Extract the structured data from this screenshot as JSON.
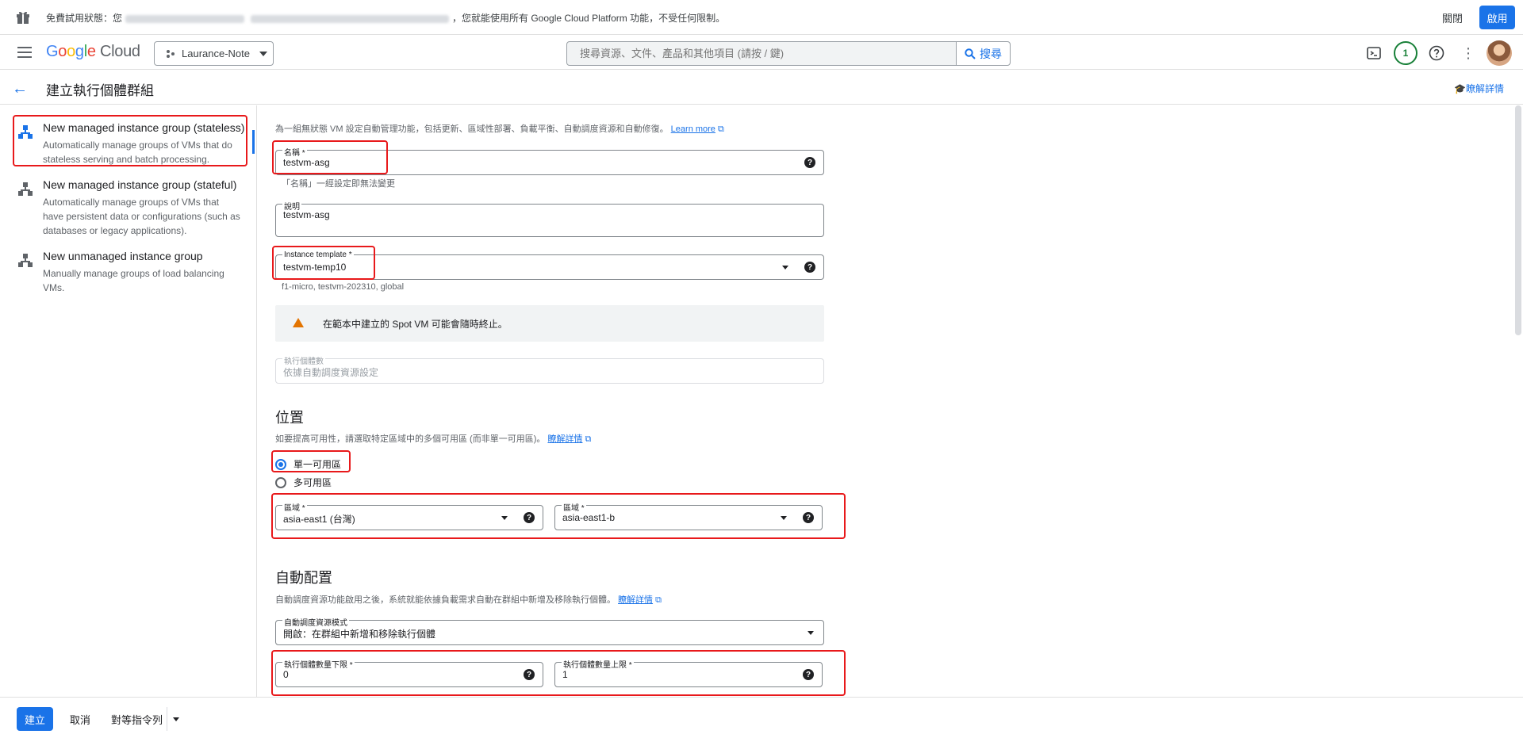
{
  "trial_banner": {
    "text_prefix": "免費試用狀態：您",
    "text_suffix": "，您就能使用所有 Google Cloud Platform 功能，不受任何限制。",
    "close_label": "關閉",
    "activate_label": "啟用"
  },
  "header": {
    "logo_parts": [
      "G",
      "o",
      "o",
      "g",
      "l",
      "e"
    ],
    "logo_product": "Cloud",
    "project_name": "Laurance-Note",
    "search_placeholder": "搜尋資源、文件、產品和其他項目 (請按 / 鍵)",
    "search_button": "搜尋",
    "notification_count": "1"
  },
  "titlebar": {
    "title": "建立執行個體群組",
    "learn_label": "瞭解詳情"
  },
  "sidebar": {
    "items": [
      {
        "title": "New managed instance group (stateless)",
        "desc": "Automatically manage groups of VMs that do stateless serving and batch processing."
      },
      {
        "title": "New managed instance group (stateful)",
        "desc": "Automatically manage groups of VMs that have persistent data or configurations (such as databases or legacy applications)."
      },
      {
        "title": "New unmanaged instance group",
        "desc": "Manually manage groups of load balancing VMs."
      }
    ]
  },
  "form": {
    "intro": "為一組無狀態 VM 設定自動管理功能，包括更新、區域性部署、負載平衡、自動調度資源和自動修復。",
    "intro_link": "Learn more",
    "name": {
      "label": "名稱 *",
      "value": "testvm-asg",
      "hint": "「名稱」一經設定即無法變更"
    },
    "description": {
      "label": "說明",
      "value": "testvm-asg"
    },
    "template": {
      "label": "Instance template *",
      "value": "testvm-temp10",
      "hint": "f1-micro, testvm-202310, global"
    },
    "warning": "在範本中建立的 Spot VM 可能會隨時終止。",
    "instances": {
      "label": "執行個體數",
      "value": "依據自動調度資源設定"
    }
  },
  "location": {
    "heading": "位置",
    "desc": "如要提高可用性，請選取特定區域中的多個可用區 (而非單一可用區)。",
    "desc_link": "瞭解詳情",
    "single_label": "單一可用區",
    "multi_label": "多可用區",
    "region": {
      "label": "區域 *",
      "value": "asia-east1 (台灣)"
    },
    "zone": {
      "label": "區域 *",
      "value": "asia-east1-b"
    }
  },
  "autoscaling": {
    "heading": "自動配置",
    "desc": "自動調度資源功能啟用之後，系統就能依據負載需求自動在群組中新增及移除執行個體。",
    "desc_link": "瞭解詳情",
    "mode": {
      "label": "自動調度資源模式",
      "value": "開啟：在群組中新增和移除執行個體"
    },
    "min": {
      "label": "執行個體數量下限 *",
      "value": "0"
    },
    "max": {
      "label": "執行個體數量上限 *",
      "value": "1"
    }
  },
  "footer": {
    "create": "建立",
    "cancel": "取消",
    "cli": "對等指令列"
  },
  "colors": {
    "primary": "#1a73e8",
    "highlight": "#e8191b",
    "warning": "#e37400"
  }
}
